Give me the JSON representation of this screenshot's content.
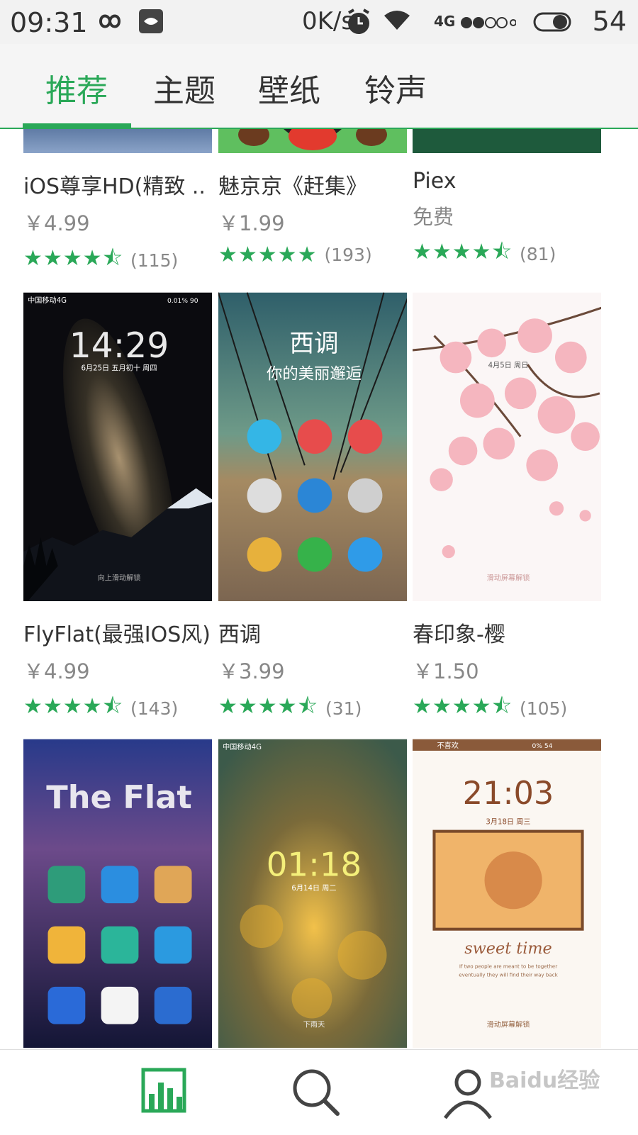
{
  "status_bar": {
    "time": "09:31",
    "speed": "0K/s",
    "network": "4G",
    "battery": "54",
    "icons": [
      "infinity-icon",
      "notification-app-icon",
      "alarm-icon",
      "wifi-icon",
      "signal-icon",
      "toggle-icon"
    ]
  },
  "tabs": [
    {
      "label": "推荐",
      "active": true
    },
    {
      "label": "主题",
      "active": false
    },
    {
      "label": "壁纸",
      "active": false
    },
    {
      "label": "铃声",
      "active": false
    }
  ],
  "accent_color": "#2aa858",
  "themes_row1": [
    {
      "title": "iOS尊享HD(精致 ..",
      "price": "￥4.99",
      "stars": "★★★★⯪",
      "rating_count": "(115)"
    },
    {
      "title": "魅京京《赶集》",
      "price": "￥1.99",
      "stars": "★★★★★",
      "rating_count": "(193)"
    },
    {
      "title": "Piex",
      "price": "免费",
      "stars": "★★★★⯪",
      "rating_count": "(81)"
    }
  ],
  "themes_row2": [
    {
      "title": "FlyFlat(最强IOS风)",
      "price": "￥4.99",
      "stars": "★★★★⯪",
      "rating_count": "(143)",
      "preview": {
        "carrier": "中国移动4G",
        "clock": "14:29",
        "date": "6月25日 五月初十 周四",
        "unlock": "向上滑动解锁",
        "battery": "0.01% 90"
      }
    },
    {
      "title": "西调",
      "price": "￥3.99",
      "stars": "★★★★⯪",
      "rating_count": "(31)",
      "preview": {
        "headline": "西调",
        "subline": "你的美丽邂逅"
      }
    },
    {
      "title": "春印象-樱",
      "price": "￥1.50",
      "stars": "★★★★⯪",
      "rating_count": "(105)",
      "preview": {
        "date": "4月5日 周日",
        "unlock": "滑动屏幕解锁"
      }
    }
  ],
  "themes_row3": [
    {
      "preview": {
        "headline": "The Flat"
      }
    },
    {
      "preview": {
        "carrier": "中国移动4G",
        "clock": "01:18",
        "date": "6月14日 周二",
        "unlock": "下雨天"
      }
    },
    {
      "preview": {
        "status_left": "不喜欢",
        "status_right": "0% 54",
        "clock": "21:03",
        "date": "3月18日 周三",
        "script": "sweet time",
        "caption1": "If two people are meant to be together",
        "caption2": "eventually they will find their way back",
        "unlock": "滑动屏幕解锁"
      }
    }
  ],
  "bottom_nav": [
    {
      "icon": "chart-bars-icon",
      "active": true
    },
    {
      "icon": "search-icon",
      "active": false
    },
    {
      "icon": "person-icon",
      "active": false
    }
  ],
  "watermark": "Baidu经验"
}
